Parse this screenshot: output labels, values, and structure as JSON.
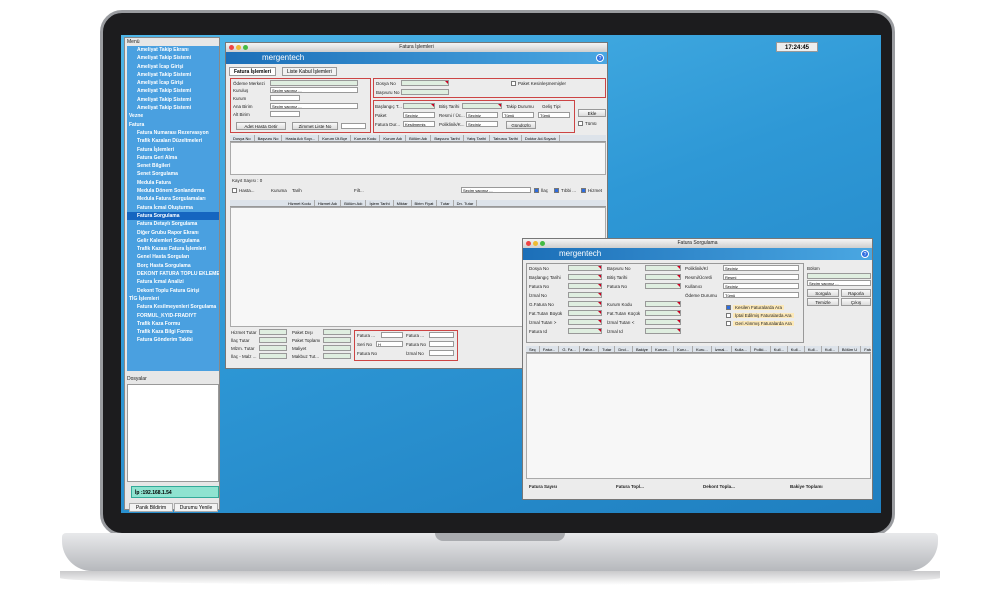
{
  "clock": "17:24:45",
  "menu": {
    "caption": "Menü",
    "items": [
      {
        "label": "Ameliyat Takip Ekranı",
        "type": "item"
      },
      {
        "label": "Ameliyat Takip Sistemi",
        "type": "item"
      },
      {
        "label": "Ameliyat İcap Girişi",
        "type": "item"
      },
      {
        "label": "Ameliyat Takip Sistemi",
        "type": "item"
      },
      {
        "label": "Ameliyat İcap Girişi",
        "type": "item"
      },
      {
        "label": "Ameliyat Takip Sistemi",
        "type": "item"
      },
      {
        "label": "Ameliyat Takip Sistemi",
        "type": "item"
      },
      {
        "label": "Ameliyat Takip Sistemi",
        "type": "item"
      },
      {
        "label": "Vezne",
        "type": "folder"
      },
      {
        "label": "Fatura",
        "type": "folder"
      },
      {
        "label": "Fatura Numarası Rezervasyon",
        "type": "item"
      },
      {
        "label": "Trafik Kazaları Düzeltmeleri",
        "type": "item"
      },
      {
        "label": "Fatura İşlemleri",
        "type": "item"
      },
      {
        "label": "Fatura Geri Alma",
        "type": "item"
      },
      {
        "label": "Senet Bilgileri",
        "type": "item"
      },
      {
        "label": "Senet Sorgulama",
        "type": "item"
      },
      {
        "label": "Medula Fatura",
        "type": "item"
      },
      {
        "label": "Medula Dönem Sonlandırma",
        "type": "item"
      },
      {
        "label": "Medula Fatura Sorgulamaları",
        "type": "item"
      },
      {
        "label": "Fatura İcmal Oluşturma",
        "type": "item"
      },
      {
        "label": "Fatura Sorgulama",
        "type": "item",
        "selected": true
      },
      {
        "label": "Fatura Detaylı Sorgulama",
        "type": "item"
      },
      {
        "label": "Diğer Grubu Rapor Ekranı",
        "type": "item"
      },
      {
        "label": "Gelir Kalemleri Sorgulama",
        "type": "item"
      },
      {
        "label": "Trafik Kazası Fatura İşlemleri",
        "type": "item"
      },
      {
        "label": "Genel Hasta Sorguları",
        "type": "item"
      },
      {
        "label": "Borç Hasta Sorgulama",
        "type": "item"
      },
      {
        "label": "DEKONT FATURA TOPLU EKLEME",
        "type": "item"
      },
      {
        "label": "Fatura İcmal Analizi",
        "type": "item"
      },
      {
        "label": "Dekont Toplu Fatura Girişi",
        "type": "item"
      },
      {
        "label": "TİG İşlemleri",
        "type": "folder"
      },
      {
        "label": "Fatura Kesilmeyenleri Sorgulama",
        "type": "item"
      },
      {
        "label": "FORMUL_KYID-FRADIYT",
        "type": "item"
      },
      {
        "label": "Trafik Kaza Formu",
        "type": "item"
      },
      {
        "label": "Trafik Kaza Bilgi Formu",
        "type": "item"
      },
      {
        "label": "Fatura Gönderim Takibi",
        "type": "item"
      }
    ],
    "dosyalar_caption": "Dosyalar",
    "ip": "İp :192.168.1.54",
    "btn_panik": "Panik Bildirim",
    "btn_yenile": "Durumu Yenile"
  },
  "win1": {
    "title": "Fatura İşlemleri",
    "logo": "mergentech",
    "tab1": "Fatura İşlemleri",
    "tab2": "Liste Kabul İşlemleri",
    "odeme_merkezi": "Ödeme Merkezi",
    "kurulus": "Kuruluş",
    "kurum": "Kurum",
    "ana_birim": "Ana Birim",
    "alt_birim": "Alt Birim",
    "secim_yapiniz": "Seçim yapınız ...",
    "btn_adet_hasta": "Adet Hasta Getir",
    "btn_zimmet": "Zimmet Liste No",
    "dosya_no": "Dosya No",
    "basvuru_no": "Başvuru No",
    "paket_kesinlesmemisler": "Paket Kesinleşmemişler",
    "baslangic": "Başlangıç T...",
    "bitis": "Bitiş Tarihi",
    "takip_durumu": "Takip Durumu",
    "gelis_tipi": "Geliş Tipi",
    "paket": "Paket",
    "resmi_uc": "Resmi / Üc...",
    "poliklinik": "Poliklinik/K...",
    "fatura_dur": "Fatura Dur...",
    "seciniz": "Seçiniz",
    "kesilmemis": "Kesilmemiş",
    "tumu": "Tümü",
    "gunduzlu": "Gündüzlü",
    "btn_ekle": "Ekle",
    "grid1_headers": [
      "Dosya No",
      "Başvuru No",
      "Hasta Adı Soyı...",
      "Kurum Üt.Bçe",
      "Kurum Kodu",
      "Kurum Adı",
      "Bölüm Adı",
      "Başvuru Tarihi",
      "Yatış Tarihi",
      "Taburcu Tarihi",
      "Doktor Ad.Soyadı"
    ],
    "kayit_sayisi": "Kayıt Sayısı : 0",
    "filter_hasta": "Hasta...",
    "filter_kuruma": "Kuruma",
    "filter_tarih": "Tarih",
    "filter_filt": "Filt...",
    "ilac": "İlaç",
    "tibbi": "Tıbbi ...",
    "hizmet": "Hizmet",
    "grid2_headers": [
      "Hizmet Kodu",
      "Hizmet Adı",
      "Bölüm Adı",
      "İşlem Tarihi",
      "Miktar",
      "Birim Fiyat",
      "Tutar",
      "Drı. Tutar"
    ],
    "sum_labels": [
      "Hizmet Tutar",
      "İlaç Tutar",
      "Mlzm. Tutar",
      "İlaç - Malz ..."
    ],
    "sum_labels2": [
      "Paket Dışı",
      "Paket Toplamı",
      "Maliyet",
      "Makbuz Tut..."
    ],
    "fatura": "Fatura ...",
    "seri_no": "Seri No",
    "fatura_no": "Fatura No",
    "seri_val": "H",
    "izmal_no": "İzmal No"
  },
  "win2": {
    "title": "Fatura Sorgulama",
    "logo": "mergentech",
    "labels_left": [
      "Dosya No",
      "Başlangıç Tarihi",
      "Fatura No",
      "İzmal No",
      "G.Fatura No",
      "Fat.Tutarı Büyük",
      "İzmal Tutarı >",
      "Fatura Id"
    ],
    "labels_mid": [
      "Başvuru No",
      "Bitiş Tarihi",
      "Fatura No",
      "",
      "Kurum Kodu",
      "Fat.Tutarı Küçük",
      "İzmal Tutarı <",
      "İzmal Id"
    ],
    "labels_right": [
      "Poliklinik/Kl",
      "Resmi/Ücretli",
      "Kullanıcı",
      "Ödeme Durumu"
    ],
    "right_vals": [
      "Seçiniz",
      "Resmi",
      "Seçiniz",
      "Tümü"
    ],
    "checks": [
      "Kesilen Faturalarda Ara",
      "İptal Edilmiş Faturalarda Ara",
      "Geri Alınmış Faturalarda Ara"
    ],
    "bolum": "Bölüm",
    "bolum_val": "Seçim yapınız ...",
    "btn_sorgula": "Sorgula",
    "btn_raporla": "Raporla",
    "btn_temizle": "Temizle",
    "btn_cikis": "Çıkış",
    "grid_headers": [
      "Seç",
      "Fatur...",
      "G. Fa...",
      "Fatur...",
      "Tutar",
      "Dnd...",
      "Bakiye",
      "Kurum...",
      "Kuru...",
      "Kuru...",
      "İzmal...",
      "Kulla...",
      "Poliki...",
      "Kull...",
      "Kull...",
      "Kull...",
      "Kull...",
      "Bölüm U",
      "Fatur...",
      "Adres",
      "Aralık"
    ],
    "footer": [
      "Fatura Sayısı",
      "Fatura Topl...",
      "Dekont Topla...",
      "Bakiye Toplamı"
    ]
  }
}
